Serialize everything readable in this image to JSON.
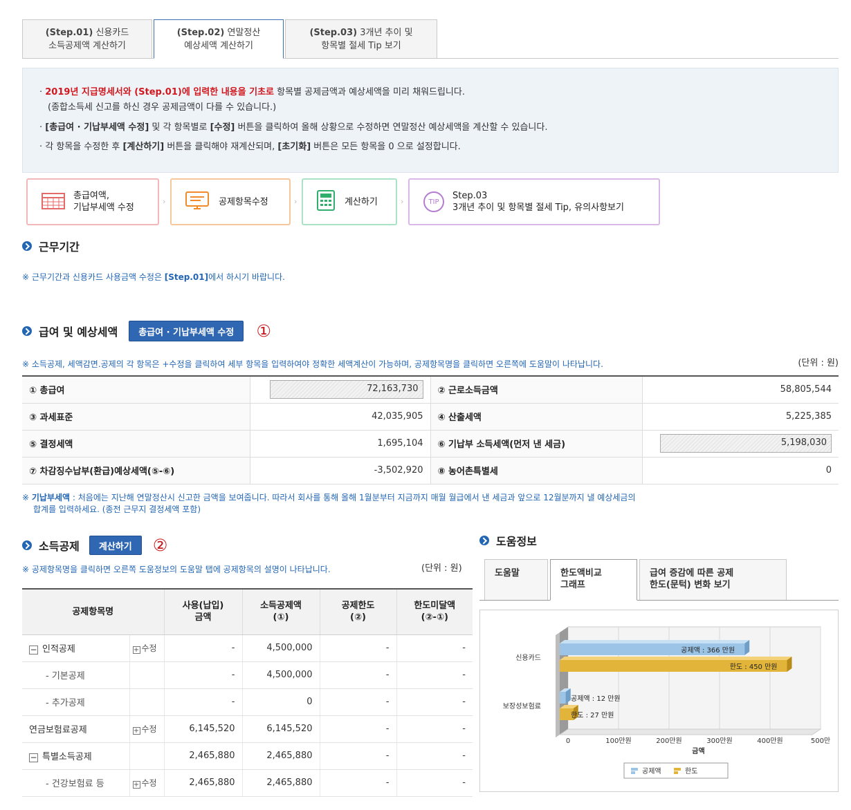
{
  "step_tabs": [
    {
      "label_bold": "(Step.01)",
      "label": " 신용카드",
      "line2": "소득공제액 계산하기"
    },
    {
      "label_bold": "(Step.02)",
      "label": " 연말정산",
      "line2": "예상세액 계산하기"
    },
    {
      "label_bold": "(Step.03)",
      "label": " 3개년 추이 및",
      "line2": "항목별 절세 Tip 보기"
    }
  ],
  "info": {
    "l1_red": "2019년 지급명세서와 (Step.01)에 입력한 내용을 기초로",
    "l1_rest": " 항목별 공제금액과 예상세액을 미리 채워드립니다.",
    "l2": "(종합소득세 신고를 하신 경우 공제금액이 다를 수 있습니다.)",
    "l3_b1": "[총급여 · 기납부세액 수정]",
    "l3_m": " 및 각 항목별로 ",
    "l3_b2": "[수정]",
    "l3_rest": " 버튼을 클릭하여 올해 상황으로 수정하면 연말정산 예상세액을 계산할 수 있습니다.",
    "l4_a": "각 항목을 수정한 후 ",
    "l4_b1": "[계산하기]",
    "l4_m": " 버튼을 클릭해야 재계산되며, ",
    "l4_b2": "[초기화]",
    "l4_rest": " 버튼은 모든 항목을 0 으로 설정합니다."
  },
  "process": {
    "p1_l1": "총급여액,",
    "p1_l2": "기납부세액 수정",
    "p2": "공제항목수정",
    "p3": "계산하기",
    "p4_badge": "TIP",
    "p4_l1": "Step.03",
    "p4_l2": "3개년 추이 및 항목별 절세 Tip, 유의사항보기"
  },
  "period": {
    "title": "근무기간",
    "note_a": "※ 근무기간과 신용카드 사용금액 수정은 ",
    "note_b": "[Step.01]",
    "note_c": "에서 하시기 바랍니다."
  },
  "salary": {
    "title": "급여 및 예상세액",
    "button": "총급여 · 기납부세액 수정",
    "mark": "①",
    "note": "※ 소득공제, 세액감면.공제의 각 항목은 +수정을 클릭하여 세부 항목을 입력하여야 정확한 세액계산이 가능하며, 공제항목명을 클릭하면 오른쪽에 도움말이 나타납니다.",
    "unit": "(단위 : 원)",
    "rows": [
      {
        "l1": "① 총급여",
        "v1": "72,163,730",
        "l2": "② 근로소득금액",
        "v2": "58,805,544"
      },
      {
        "l1": "③ 과세표준",
        "v1": "42,035,905",
        "l2": "④ 산출세액",
        "v2": "5,225,385"
      },
      {
        "l1": "⑤ 결정세액",
        "v1": "1,695,104",
        "l2": "⑥ 기납부 소득세액(먼저 낸 세금)",
        "v2": "5,198,030"
      },
      {
        "l1": "⑦ 차감징수납부(환급)예상세액(⑤-⑥)",
        "v1": "-3,502,920",
        "l2": "⑧ 농어촌특별세",
        "v2": "0"
      }
    ],
    "foot_b": "기납부세액",
    "foot_1": " : 처음에는 지난해 연말정산시 신고한 금액을 보여줍니다. 따라서 회사를 통해 올해 1월분부터 지금까지 매월 월급에서 낸 세금과 앞으로 12월분까지 낼 예상세금의",
    "foot_2": "합계를 입력하세요. (종전 근무지 결정세액 포함)",
    "foot_mark": "※ "
  },
  "deduction": {
    "title": "소득공제",
    "button": "계산하기",
    "mark": "②",
    "note": "※ 공제항목명을 클릭하면 오른쪽 도움정보의 도움말 탭에 공제항목의 설명이 나타납니다.",
    "unit": "(단위 : 원)",
    "headers": [
      "공제항목명",
      "사용(납입)\n금액",
      "소득공제액\n(①)",
      "공제한도\n(②)",
      "한도미달액\n(②-①)"
    ],
    "mod_label": "수정",
    "rows": [
      {
        "name": "인적공제",
        "toggle": "−",
        "mod": true,
        "used": "-",
        "ded": "4,500,000",
        "lim": "-",
        "short": "-"
      },
      {
        "name": "- 기본공제",
        "sub": true,
        "mod": false,
        "used": "-",
        "ded": "4,500,000",
        "lim": "-",
        "short": "-"
      },
      {
        "name": "- 추가공제",
        "sub": true,
        "mod": false,
        "used": "-",
        "ded": "0",
        "lim": "-",
        "short": "-"
      },
      {
        "name": "연금보험료공제",
        "mod": true,
        "used": "6,145,520",
        "ded": "6,145,520",
        "lim": "-",
        "short": "-"
      },
      {
        "name": "특별소득공제",
        "toggle": "−",
        "mod": false,
        "used": "2,465,880",
        "ded": "2,465,880",
        "lim": "-",
        "short": "-"
      },
      {
        "name": "- 건강보험료 등",
        "sub": true,
        "mod": true,
        "used": "2,465,880",
        "ded": "2,465,880",
        "lim": "-",
        "short": "-"
      }
    ]
  },
  "help": {
    "title": "도움정보",
    "tabs": [
      "도움말",
      "한도액비교\n그래프",
      "급여 증감에 따른 공제\n한도(문턱) 변화 보기"
    ]
  },
  "chart_data": {
    "type": "bar",
    "orientation": "horizontal",
    "categories": [
      "신용카드",
      "보장성보험료"
    ],
    "series": [
      {
        "name": "공제액",
        "values": [
          366,
          12
        ],
        "labels": [
          "공제액 : 366 만원",
          "공제액 : 12 만원"
        ],
        "color": "#9cc4e6"
      },
      {
        "name": "한도",
        "values": [
          450,
          27
        ],
        "labels": [
          "한도 : 450 만원",
          "한도 : 27 만원"
        ],
        "color": "#e2b53a"
      }
    ],
    "xlabel": "금액",
    "xticks": [
      "0",
      "100만원",
      "200만원",
      "300만원",
      "400만원",
      "500만"
    ],
    "xlim": [
      0,
      500
    ],
    "legend": "bottom-center",
    "grid": true
  }
}
